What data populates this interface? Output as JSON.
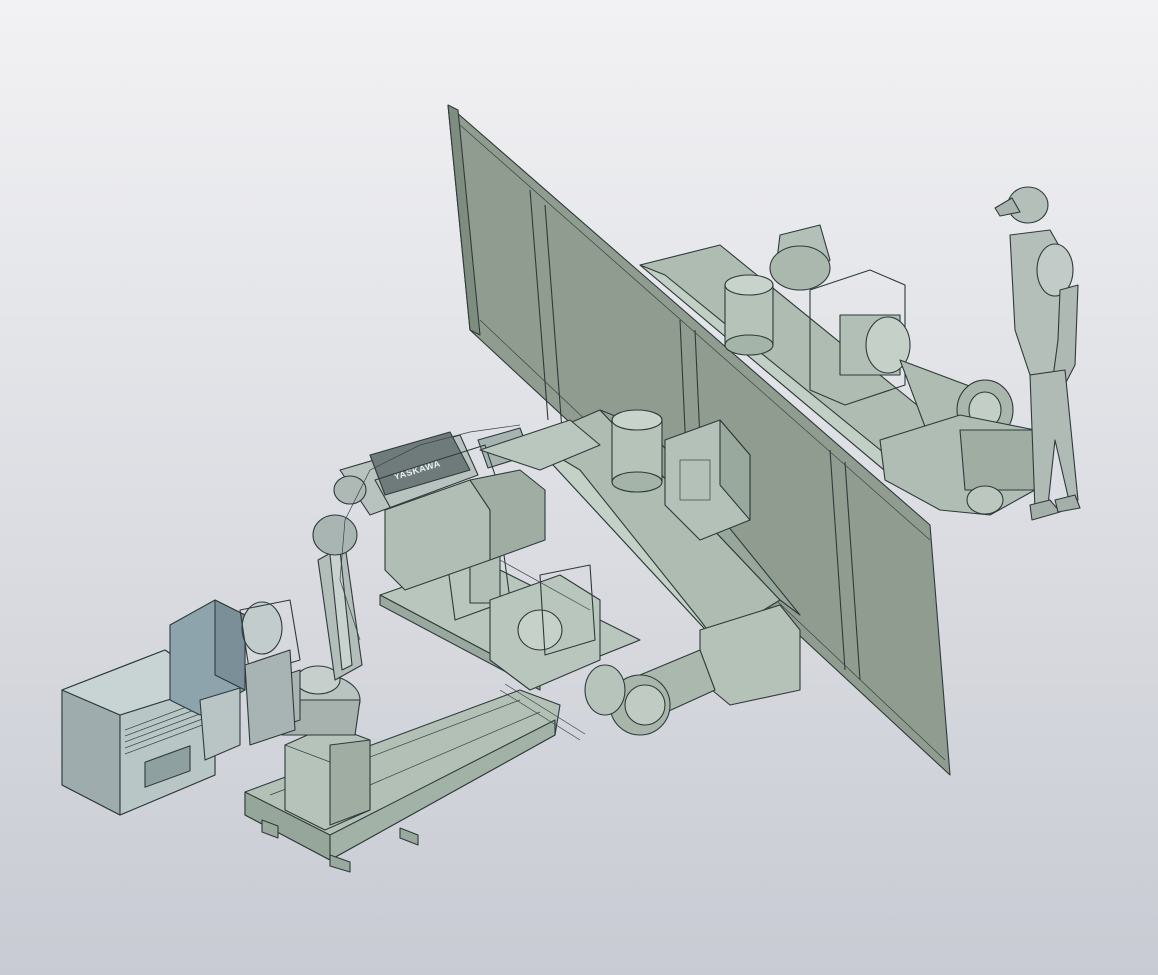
{
  "scene": {
    "background_top": "#f2f2f4",
    "background_bottom": "#c8cbd3",
    "body_color": "#a9b8ad",
    "panel_color": "#8f9c8f",
    "controller_color": "#b3c0c0",
    "controller_accent": "#8ea4ad",
    "robot_color": "#b9c3c0",
    "human_color": "#b5bfba"
  },
  "labels": {
    "robot_brand": "YASKAWA"
  }
}
